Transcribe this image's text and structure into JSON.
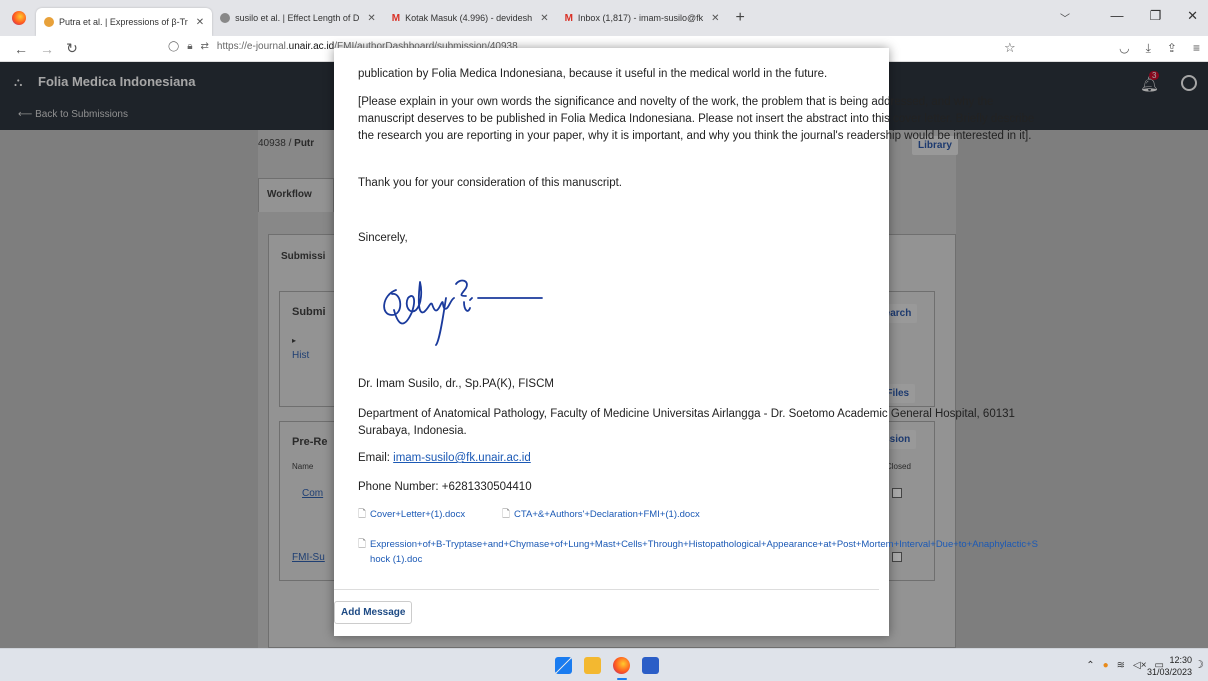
{
  "browser": {
    "tabs": [
      {
        "title": "Putra et al. | Expressions of β-Tr",
        "active": true,
        "fav_color": "#e8a13a"
      },
      {
        "title": "susilo et al. | Effect Length of D",
        "active": false,
        "fav_color": "#888888"
      },
      {
        "title": "Kotak Masuk (4.996) - devidesh",
        "active": false,
        "fav_color": "#d93025"
      },
      {
        "title": "Inbox (1,817) - imam-susilo@fk",
        "active": false,
        "fav_color": "#d93025"
      }
    ],
    "new_tab_label": "+",
    "url_prefix": "https://e-journal.",
    "url_domain": "unair.ac.id",
    "url_path": "/FMI/authorDashboard/submission/40938"
  },
  "site": {
    "journal_name": "Folia Medica Indonesiana",
    "back_link": "Back to Submissions",
    "notification_count": "3",
    "breadcrumb": "40938 /",
    "breadcrumb_bold": "Putr",
    "library_btn": "Library",
    "workflow_tab": "Workflow",
    "submission_tab": "Submissi",
    "card1_title": "Submi",
    "card1_link": "Hist",
    "search_btn": "Search",
    "all_files_btn": "ll Files",
    "card2_title": "Pre-Re",
    "col_name": "Name",
    "col_closed": "Closed",
    "discussion_btn": "ussion",
    "row_link": "Com",
    "file_link_bg": "FMI-Su"
  },
  "modal": {
    "line1": "publication by Folia Medica Indonesiana, because it useful in the medical world in the future.",
    "para2": "[Please explain in your own words the significance and novelty of the work, the problem that is being addressed, and why the manuscript deserves to be published in Folia Medica Indonesiana. Please not insert the abstract into this cover letter. Briefly describe the research you are reporting in your paper, why it is important, and why you think the journal's readership would be interested in it].",
    "thanks": "Thank you for your consideration of this manuscript.",
    "sincerely": "Sincerely,",
    "signer_name": "Dr. Imam Susilo, dr., Sp.PA(K), FISCM",
    "department": "Department of Anatomical Pathology, Faculty of Medicine Universitas Airlangga - Dr. Soetomo Academic General Hospital, 60131 Surabaya, Indonesia.",
    "email_label": "Email:",
    "email": "imam-susilo@fk.unair.ac.id",
    "phone": "Phone Number: +6281330504410",
    "files": [
      "Cover+Letter+(1).docx",
      "CTA+&+Authors'+Declaration+FMI+(1).docx"
    ],
    "long_file": "Expression+of+B-Tryptase+and+Chymase+of+Lung+Mast+Cells+Through+Histopathological+Appearance+at+Post+Mortem+Interval+Due+to+Anaphylactic+Shock (1).doc",
    "add_message": "Add Message"
  },
  "taskbar": {
    "time": "12:30",
    "date": "31/03/2023"
  }
}
